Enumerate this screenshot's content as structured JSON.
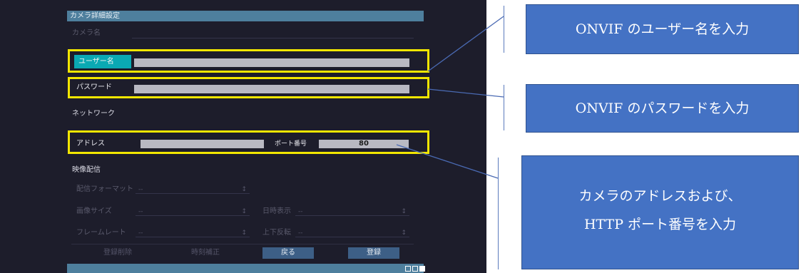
{
  "panel": {
    "title": "カメラ詳細設定",
    "camera_name_label": "カメラ名",
    "username_label": "ユーザー名",
    "username_value": "",
    "password_label": "パスワード",
    "password_value": "",
    "network_heading": "ネットワーク",
    "address_label": "アドレス",
    "address_value": "",
    "port_label": "ポート番号",
    "port_value": "80",
    "video_heading": "映像配信",
    "format_label": "配信フォーマット",
    "format_value": "--",
    "image_size_label": "画像サイズ",
    "image_size_value": "--",
    "datetime_label": "日時表示",
    "datetime_value": "--",
    "framerate_label": "フレームレート",
    "framerate_value": "--",
    "flip_label": "上下反転",
    "flip_value": "--",
    "buttons": {
      "delete": "登録削除",
      "time_adjust": "時刻補正",
      "back": "戻る",
      "register": "登録"
    }
  },
  "callouts": {
    "username": "ONVIF のユーザー名を入力",
    "password": "ONVIF のパスワードを入力",
    "address_line1": "カメラのアドレスおよび、",
    "address_line2": "HTTP ポート番号を入力"
  },
  "colors": {
    "panel_bg": "#1d1d2b",
    "title_bar": "#4e7f9d",
    "highlight_tab": "#0aa9b3",
    "annotation_box": "#f2e600",
    "callout_fill": "#4472c4"
  }
}
